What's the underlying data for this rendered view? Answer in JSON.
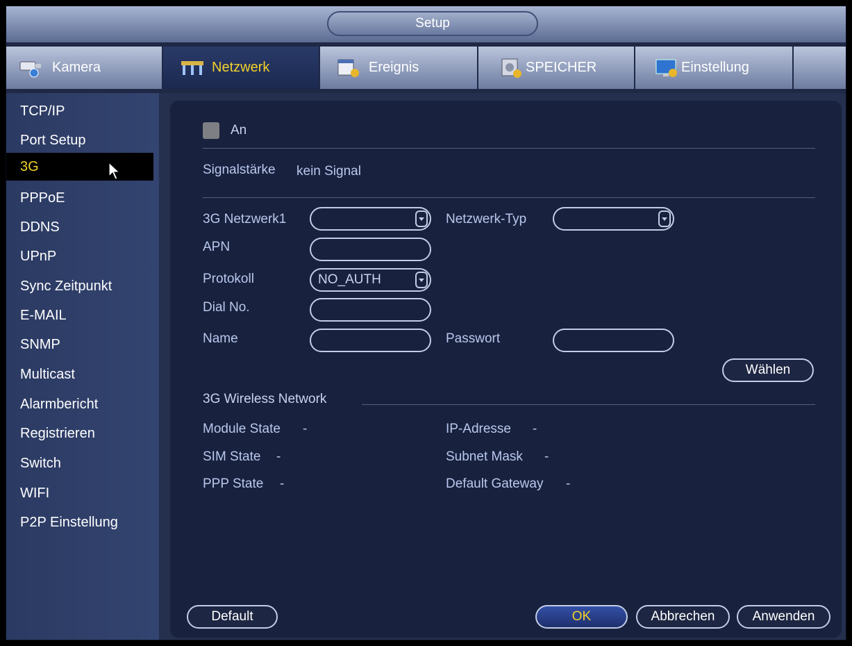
{
  "window": {
    "title": "Setup"
  },
  "tabs": [
    {
      "label": "Kamera",
      "icon": "camera-icon",
      "active": false
    },
    {
      "label": "Netzwerk",
      "icon": "network-icon",
      "active": true
    },
    {
      "label": "Ereignis",
      "icon": "event-icon",
      "active": false
    },
    {
      "label": "SPEICHER",
      "icon": "storage-icon",
      "active": false
    },
    {
      "label": "Einstellung",
      "icon": "settings-icon",
      "active": false
    }
  ],
  "sidebar": {
    "items": [
      {
        "label": "TCP/IP"
      },
      {
        "label": "Port Setup"
      },
      {
        "label": "3G",
        "selected": true
      },
      {
        "label": "PPPoE"
      },
      {
        "label": "DDNS"
      },
      {
        "label": "UPnP"
      },
      {
        "label": "Sync Zeitpunkt"
      },
      {
        "label": "E-MAIL"
      },
      {
        "label": "SNMP"
      },
      {
        "label": "Multicast"
      },
      {
        "label": "Alarmbericht"
      },
      {
        "label": "Registrieren"
      },
      {
        "label": "Switch"
      },
      {
        "label": "WIFI"
      },
      {
        "label": "P2P Einstellung"
      }
    ]
  },
  "form": {
    "enable_label": "An",
    "enable_checked": false,
    "signal_label": "Signalstärke",
    "signal_value": "kein Signal",
    "network_label": "3G Netzwerk1",
    "network_value": "",
    "network_type_label": "Netzwerk-Typ",
    "network_type_value": "",
    "apn_label": "APN",
    "apn_value": "",
    "protocol_label": "Protokoll",
    "protocol_value": "NO_AUTH",
    "dial_label": "Dial No.",
    "dial_value": "",
    "name_label": "Name",
    "name_value": "",
    "password_label": "Passwort",
    "password_value": "",
    "dial_button": "Wählen"
  },
  "wireless": {
    "section_title": "3G Wireless Network",
    "module_state_label": "Module State",
    "module_state_value": "-",
    "sim_state_label": "SIM State",
    "sim_state_value": "-",
    "ppp_state_label": "PPP State",
    "ppp_state_value": "-",
    "ip_label": "IP-Adresse",
    "ip_value": "-",
    "subnet_label": "Subnet Mask",
    "subnet_value": "-",
    "gateway_label": "Default Gateway",
    "gateway_value": "-"
  },
  "buttons": {
    "default": "Default",
    "ok": "OK",
    "cancel": "Abbrechen",
    "apply": "Anwenden"
  },
  "colors": {
    "accent": "#f3d12a",
    "panel_bg": "#18213d",
    "label": "#b9c8ee"
  }
}
